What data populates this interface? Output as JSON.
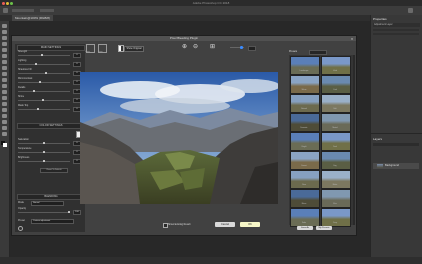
{
  "window": {
    "title": "Adobe Photoshop CC 2018",
    "doc_tab": "Mountain@100% (RGB/8)"
  },
  "plugin": {
    "title": "Pixel Bleeding Plugin",
    "top_icons": [
      {
        "icon": "image-icon",
        "label": "Open"
      },
      {
        "icon": "save-icon",
        "label": "Save"
      }
    ],
    "compare_label": "Show Original",
    "sections": {
      "main_settings": "MAIN SETTINGS",
      "color_settings": "COLOR SETTINGS",
      "blending": "BLENDING"
    },
    "main_sliders": [
      {
        "label": "Strength",
        "value": "0"
      },
      {
        "label": "Lighting",
        "value": "0"
      },
      {
        "label": "Shadows Fill",
        "value": "0"
      },
      {
        "label": "Microcontrast",
        "value": "0"
      },
      {
        "label": "Details",
        "value": "0"
      },
      {
        "label": "Shine",
        "value": "0"
      },
      {
        "label": "Mask Top",
        "value": "0"
      }
    ],
    "color_sliders": [
      {
        "label": "Saturation",
        "value": "0"
      },
      {
        "label": "Temperature",
        "value": "0"
      },
      {
        "label": "Brightness",
        "value": "0"
      }
    ],
    "blend_rows": [
      {
        "label": "Mode",
        "value": "Normal"
      },
      {
        "label": "Opacity",
        "value": "100"
      },
      {
        "label": "Preset",
        "value": "Custom adjustment"
      }
    ],
    "reset_label": "Reset To Default",
    "footer_check": "Show Existing Result",
    "cancel_label": "Cancel",
    "ok_label": "OK",
    "preset_header": "Presets",
    "presets": [
      "Landscape",
      "Vivid",
      "Warm",
      "Cool",
      "Natural",
      "Soft",
      "Dramatic",
      "Muted",
      "Bright",
      "Dark",
      "Sunset",
      "Fog",
      "Clear",
      "Matte",
      "Mono",
      "Film",
      "Fade",
      "Crisp"
    ],
    "preset_buttons": [
      "Save As",
      "My Presets"
    ]
  },
  "right_panel": {
    "properties": "Properties",
    "adjust_label": "Adjustment Layer",
    "layers": "Layers",
    "layer_name": "Background"
  },
  "colors": {
    "accent": "#2f6fcb",
    "ok": "#f7f7c8"
  }
}
